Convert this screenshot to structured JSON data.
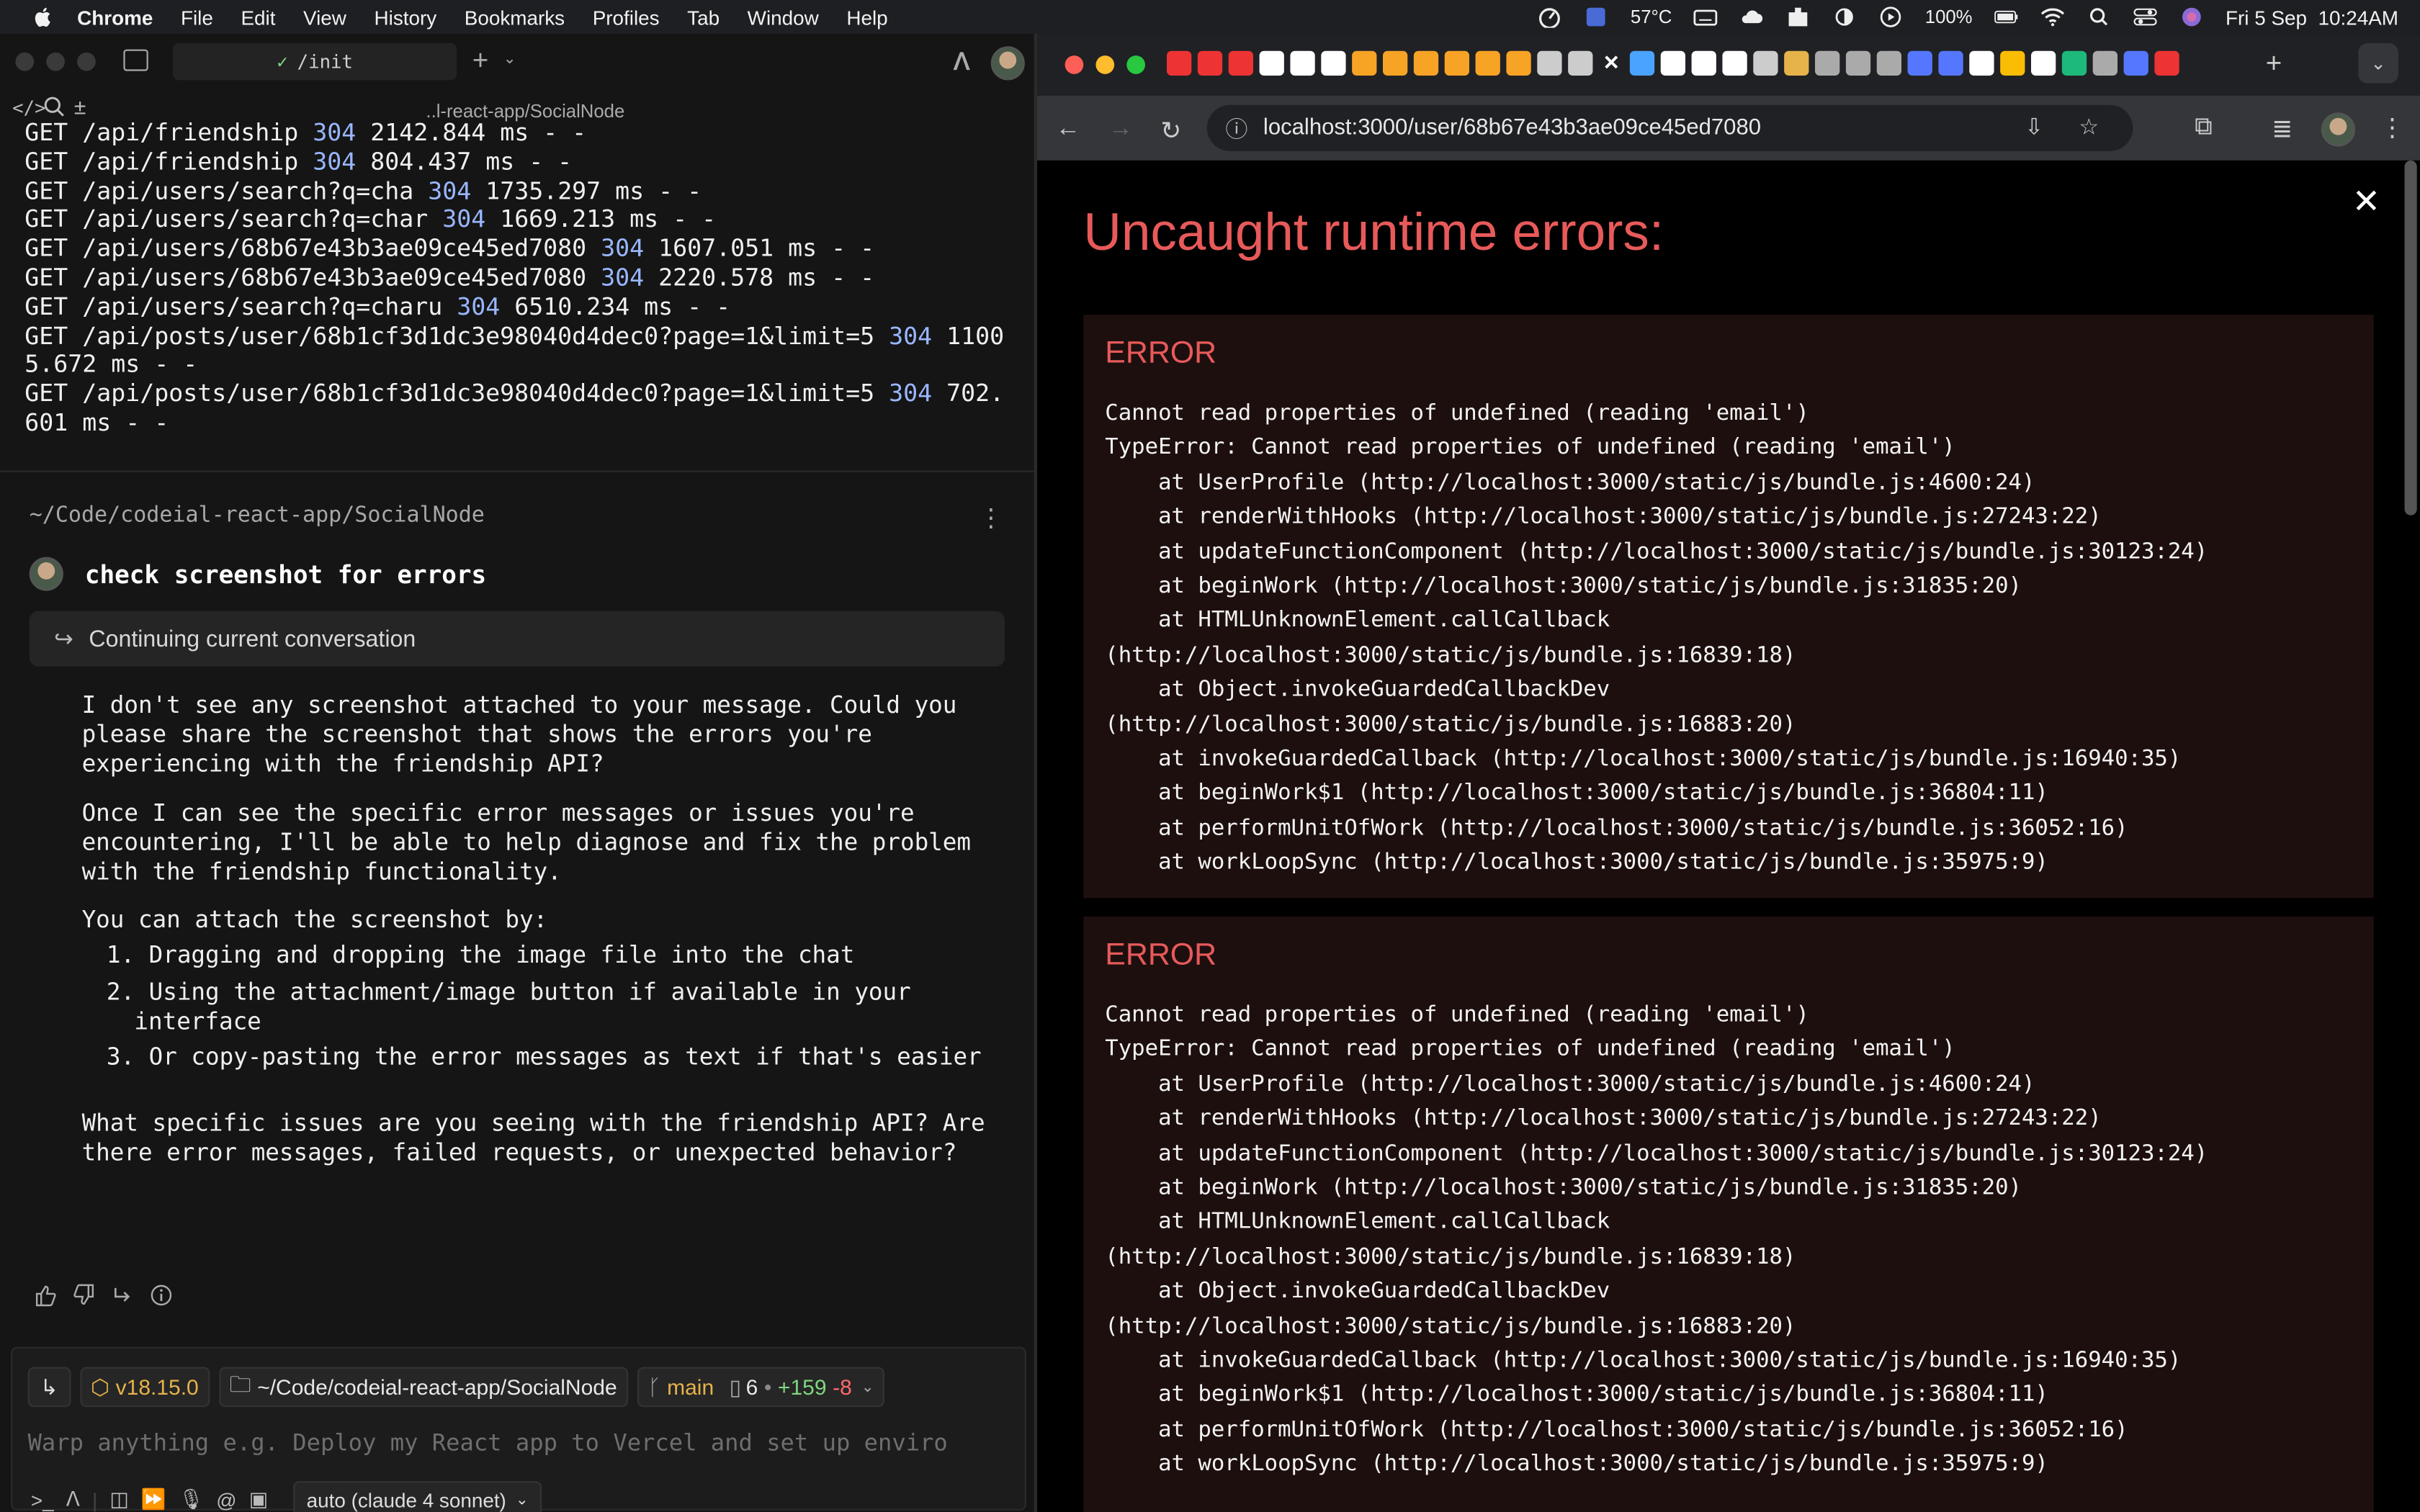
{
  "menubar": {
    "app": "Chrome",
    "items": [
      "File",
      "Edit",
      "View",
      "History",
      "Bookmarks",
      "Profiles",
      "Tab",
      "Window",
      "Help"
    ],
    "temperature": "57°C",
    "battery": "100%",
    "datetime": "Fri 5 Sep  10:24AM"
  },
  "warp": {
    "tab_title": "/init",
    "path_short": "..l-react-app/SocialNode",
    "log_lines": [
      {
        "pre": "GET /api/friendship ",
        "code": "304",
        "post": " 2142.844 ms - -"
      },
      {
        "pre": "GET /api/friendship ",
        "code": "304",
        "post": " 804.437 ms - -"
      },
      {
        "pre": "GET /api/users/search?q=cha ",
        "code": "304",
        "post": " 1735.297 ms - -"
      },
      {
        "pre": "GET /api/users/search?q=char ",
        "code": "304",
        "post": " 1669.213 ms - -"
      },
      {
        "pre": "GET /api/users/68b67e43b3ae09ce45ed7080 ",
        "code": "304",
        "post": " 1607.051 ms - -"
      },
      {
        "pre": "GET /api/users/68b67e43b3ae09ce45ed7080 ",
        "code": "304",
        "post": " 2220.578 ms - -"
      },
      {
        "pre": "GET /api/users/search?q=charu ",
        "code": "304",
        "post": " 6510.234 ms - -"
      },
      {
        "pre": "GET /api/posts/user/68b1cf3d1dc3e98040d4dec0?page=1&limit=5 ",
        "code": "304",
        "post": " 11005.672 ms - -"
      },
      {
        "pre": "GET /api/posts/user/68b1cf3d1dc3e98040d4dec0?page=1&limit=5 ",
        "code": "304",
        "post": " 702.601 ms - -"
      }
    ],
    "block_path": "~/Code/codeial-react-app/SocialNode",
    "prompt": "check screenshot for errors",
    "continuing": "Continuing current conversation",
    "answer": {
      "p1": "I don't see any screenshot attached to your message. Could you please share the screenshot that shows the errors you're experiencing with the friendship API?",
      "p2": "Once I can see the specific error messages or issues you're encountering, I'll be able to help diagnose and fix the problem with the friendship functionality.",
      "p3": "You can attach the screenshot by:",
      "list": [
        "1. Dragging and dropping the image file into the chat",
        "2. Using the attachment/image button if available in your interface",
        "3. Or copy-pasting the error messages as text if that's easier"
      ],
      "p4": "What specific issues are you seeing with the friendship API? Are there error messages, failed requests, or unexpected behavior?"
    },
    "chips": {
      "node": "v18.15.0",
      "dir": "~/Code/codeial-react-app/SocialNode",
      "branch": "main",
      "files": "6",
      "added": "+159",
      "removed": "-8"
    },
    "input_placeholder": "Warp anything e.g. Deploy my React app to Vercel and set up enviro",
    "model": "auto (claude 4 sonnet)"
  },
  "chrome": {
    "url": "localhost:3000/user/68b67e43b3ae09ce45ed7080",
    "overlay_title": "Uncaught runtime errors:",
    "errors": [
      {
        "label": "ERROR",
        "text": "Cannot read properties of undefined (reading 'email')\nTypeError: Cannot read properties of undefined (reading 'email')\n    at UserProfile (http://localhost:3000/static/js/bundle.js:4600:24)\n    at renderWithHooks (http://localhost:3000/static/js/bundle.js:27243:22)\n    at updateFunctionComponent (http://localhost:3000/static/js/bundle.js:30123:24)\n    at beginWork (http://localhost:3000/static/js/bundle.js:31835:20)\n    at HTMLUnknownElement.callCallback\n(http://localhost:3000/static/js/bundle.js:16839:18)\n    at Object.invokeGuardedCallbackDev\n(http://localhost:3000/static/js/bundle.js:16883:20)\n    at invokeGuardedCallback (http://localhost:3000/static/js/bundle.js:16940:35)\n    at beginWork$1 (http://localhost:3000/static/js/bundle.js:36804:11)\n    at performUnitOfWork (http://localhost:3000/static/js/bundle.js:36052:16)\n    at workLoopSync (http://localhost:3000/static/js/bundle.js:35975:9)"
      },
      {
        "label": "ERROR",
        "text": "Cannot read properties of undefined (reading 'email')\nTypeError: Cannot read properties of undefined (reading 'email')\n    at UserProfile (http://localhost:3000/static/js/bundle.js:4600:24)\n    at renderWithHooks (http://localhost:3000/static/js/bundle.js:27243:22)\n    at updateFunctionComponent (http://localhost:3000/static/js/bundle.js:30123:24)\n    at beginWork (http://localhost:3000/static/js/bundle.js:31835:20)\n    at HTMLUnknownElement.callCallback\n(http://localhost:3000/static/js/bundle.js:16839:18)\n    at Object.invokeGuardedCallbackDev\n(http://localhost:3000/static/js/bundle.js:16883:20)\n    at invokeGuardedCallback (http://localhost:3000/static/js/bundle.js:16940:35)\n    at beginWork$1 (http://localhost:3000/static/js/bundle.js:36804:11)\n    at performUnitOfWork (http://localhost:3000/static/js/bundle.js:36052:16)\n    at workLoopSync (http://localhost:3000/static/js/bundle.js:35975:9)"
      }
    ]
  }
}
